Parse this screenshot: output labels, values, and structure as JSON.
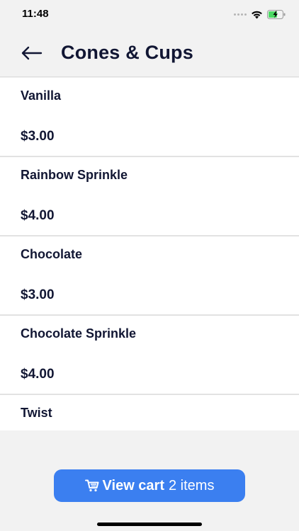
{
  "status_bar": {
    "time": "11:48",
    "icons": [
      "signal-dots-icon",
      "wifi-icon",
      "battery-charging-icon"
    ]
  },
  "header": {
    "back_icon": "arrow-left-icon",
    "title": "Cones & Cups"
  },
  "items": [
    {
      "name": "Vanilla",
      "price": "$3.00"
    },
    {
      "name": "Rainbow Sprinkle",
      "price": "$4.00"
    },
    {
      "name": "Chocolate",
      "price": "$3.00"
    },
    {
      "name": "Chocolate Sprinkle",
      "price": "$4.00"
    },
    {
      "name": "Twist",
      "price": ""
    }
  ],
  "cart_button": {
    "icon": "cart-icon",
    "label": "View cart",
    "count": "2 items"
  },
  "colors": {
    "accent": "#3b7ff0",
    "text": "#111633",
    "background": "#f2f2f2",
    "battery": "#4cd964"
  }
}
